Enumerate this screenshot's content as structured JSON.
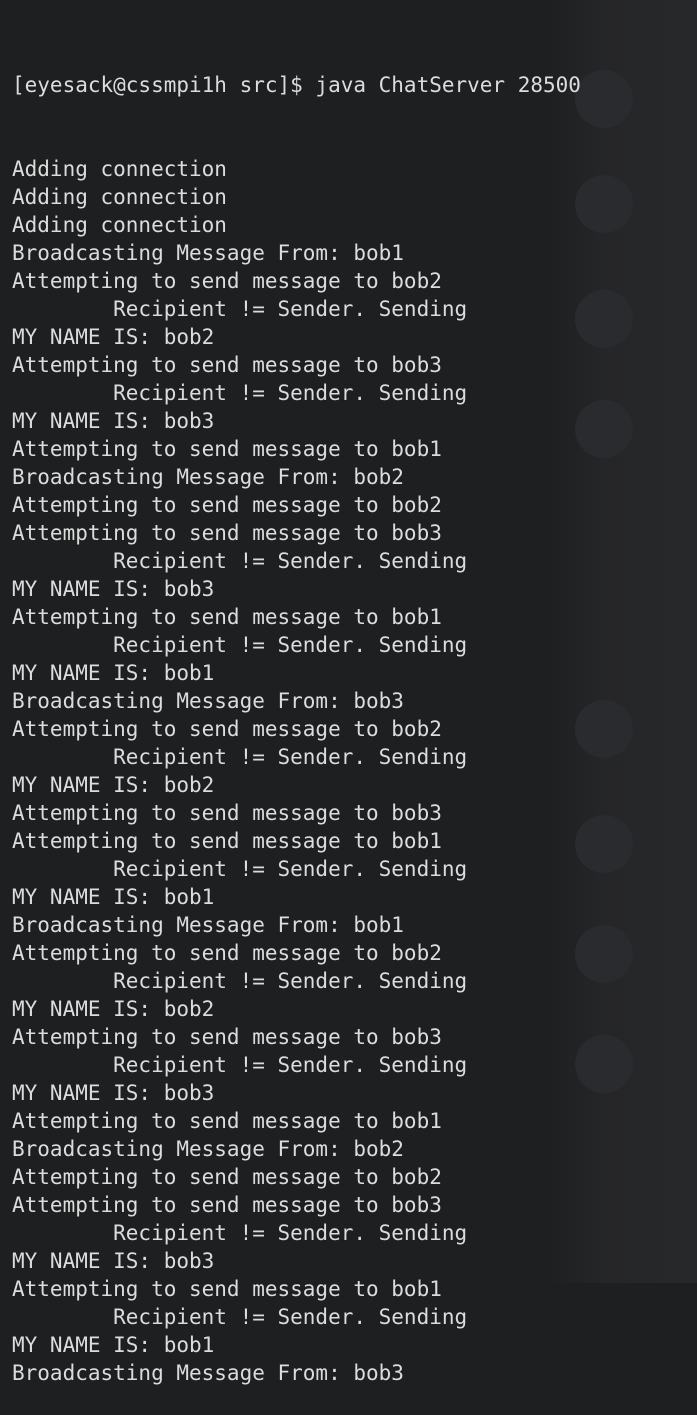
{
  "terminal": {
    "prompt": "[eyesack@cssmpi1h src]$ java ChatServer 28500",
    "lines": [
      "Adding connection",
      "Adding connection",
      "Adding connection",
      "Broadcasting Message From: bob1",
      "Attempting to send message to bob2",
      "        Recipient != Sender. Sending",
      "MY NAME IS: bob2",
      "Attempting to send message to bob3",
      "        Recipient != Sender. Sending",
      "MY NAME IS: bob3",
      "Attempting to send message to bob1",
      "Broadcasting Message From: bob2",
      "Attempting to send message to bob2",
      "Attempting to send message to bob3",
      "        Recipient != Sender. Sending",
      "MY NAME IS: bob3",
      "Attempting to send message to bob1",
      "        Recipient != Sender. Sending",
      "MY NAME IS: bob1",
      "Broadcasting Message From: bob3",
      "Attempting to send message to bob2",
      "        Recipient != Sender. Sending",
      "MY NAME IS: bob2",
      "Attempting to send message to bob3",
      "Attempting to send message to bob1",
      "        Recipient != Sender. Sending",
      "MY NAME IS: bob1",
      "Broadcasting Message From: bob1",
      "Attempting to send message to bob2",
      "        Recipient != Sender. Sending",
      "MY NAME IS: bob2",
      "Attempting to send message to bob3",
      "        Recipient != Sender. Sending",
      "MY NAME IS: bob3",
      "Attempting to send message to bob1",
      "Broadcasting Message From: bob2",
      "Attempting to send message to bob2",
      "Attempting to send message to bob3",
      "        Recipient != Sender. Sending",
      "MY NAME IS: bob3",
      "Attempting to send message to bob1",
      "        Recipient != Sender. Sending",
      "MY NAME IS: bob1",
      "Broadcasting Message From: bob3"
    ]
  },
  "colors": {
    "background": "#1e1f20",
    "text": "#dcdcdc"
  }
}
